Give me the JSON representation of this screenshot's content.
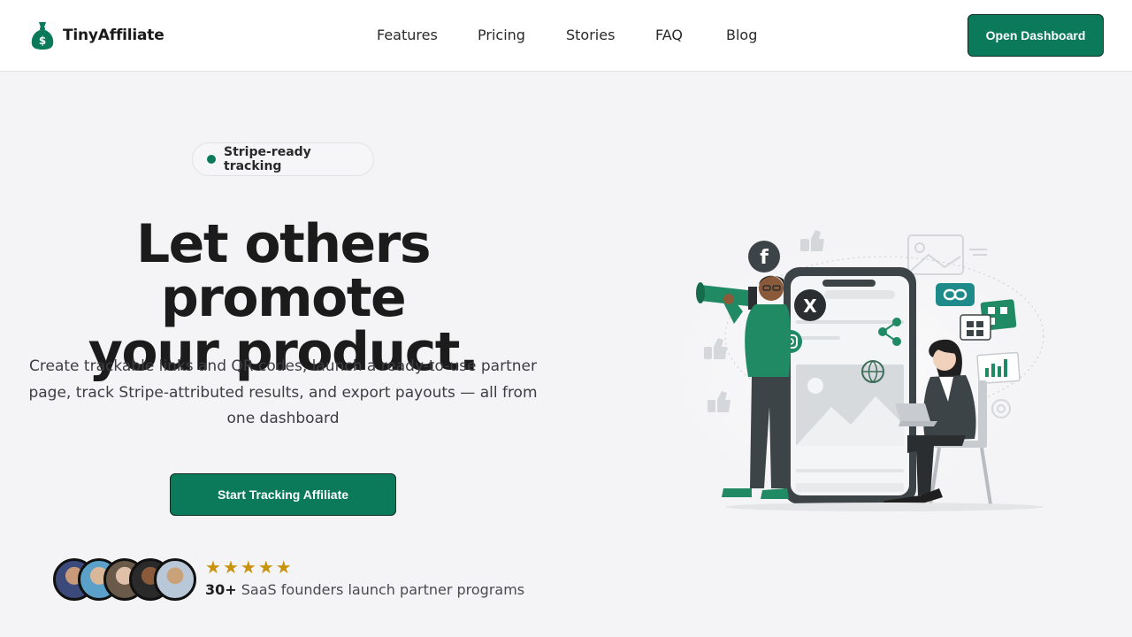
{
  "brand": {
    "name": "TinyAffiliate",
    "logo_icon": "money-bag-icon"
  },
  "nav": {
    "links": [
      "Features",
      "Pricing",
      "Stories",
      "FAQ",
      "Blog"
    ],
    "cta": "Open Dashboard"
  },
  "badge": {
    "text": "Stripe-ready tracking"
  },
  "hero": {
    "title_line1": "Let others promote",
    "title_line2": "your product.",
    "subtitle": "Create trackable links and QR codes, launch a ready-to-use partner page, track Stripe-attributed results, and export payouts — all from one dashboard",
    "cta": "Start Tracking Affiliate"
  },
  "social_proof": {
    "stars": 5,
    "count": "30+",
    "text": "SaaS founders launch partner programs"
  },
  "colors": {
    "accent": "#0a7a5a",
    "star": "#c9930c",
    "background": "#f4f4f6"
  }
}
